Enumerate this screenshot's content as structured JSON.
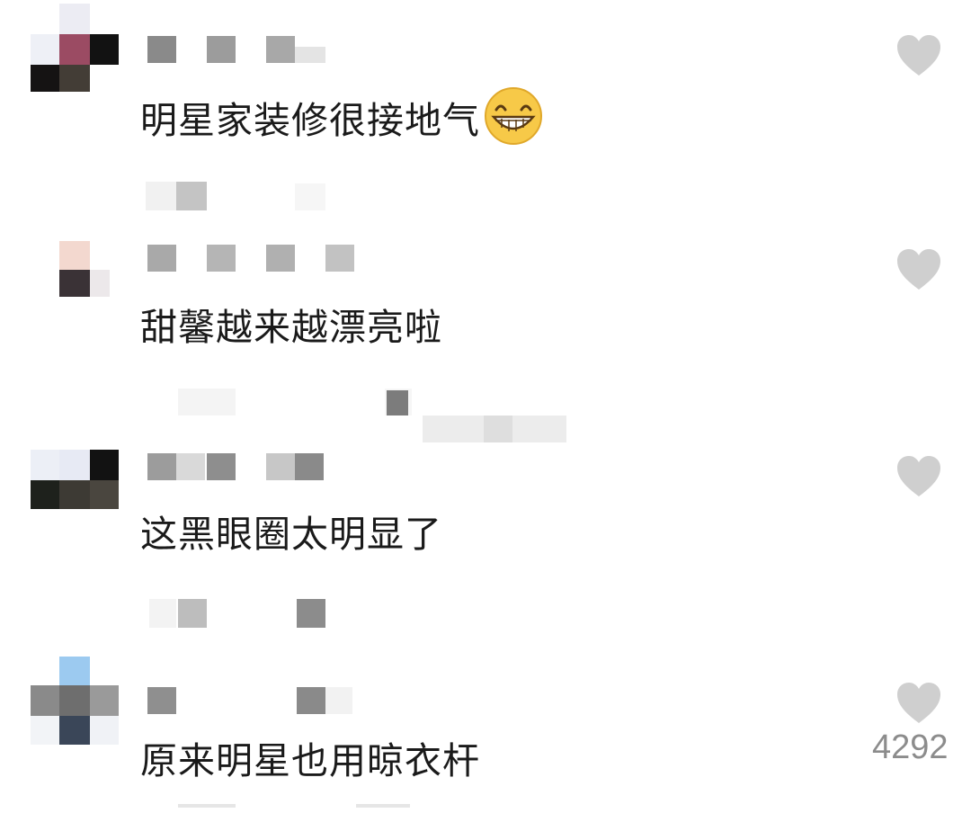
{
  "comments": [
    {
      "text": "明星家装修很接地气",
      "emoji": "grinning-face-emoji",
      "like_count": ""
    },
    {
      "text": "甜馨越来越漂亮啦",
      "like_count": ""
    },
    {
      "text": "这黑眼圈太明显了",
      "like_count": ""
    },
    {
      "text": "原来明星也用晾衣杆",
      "like_count": "4292"
    }
  ],
  "icons": {
    "like": "heart-icon",
    "emoji": "grinning-face-emoji"
  },
  "colors": {
    "background": "#ffffff",
    "comment_text": "#1a1a1a",
    "heart": "#cfcfcf",
    "like_count": "#8c8c8c",
    "emoji_face": "#f7c948"
  }
}
